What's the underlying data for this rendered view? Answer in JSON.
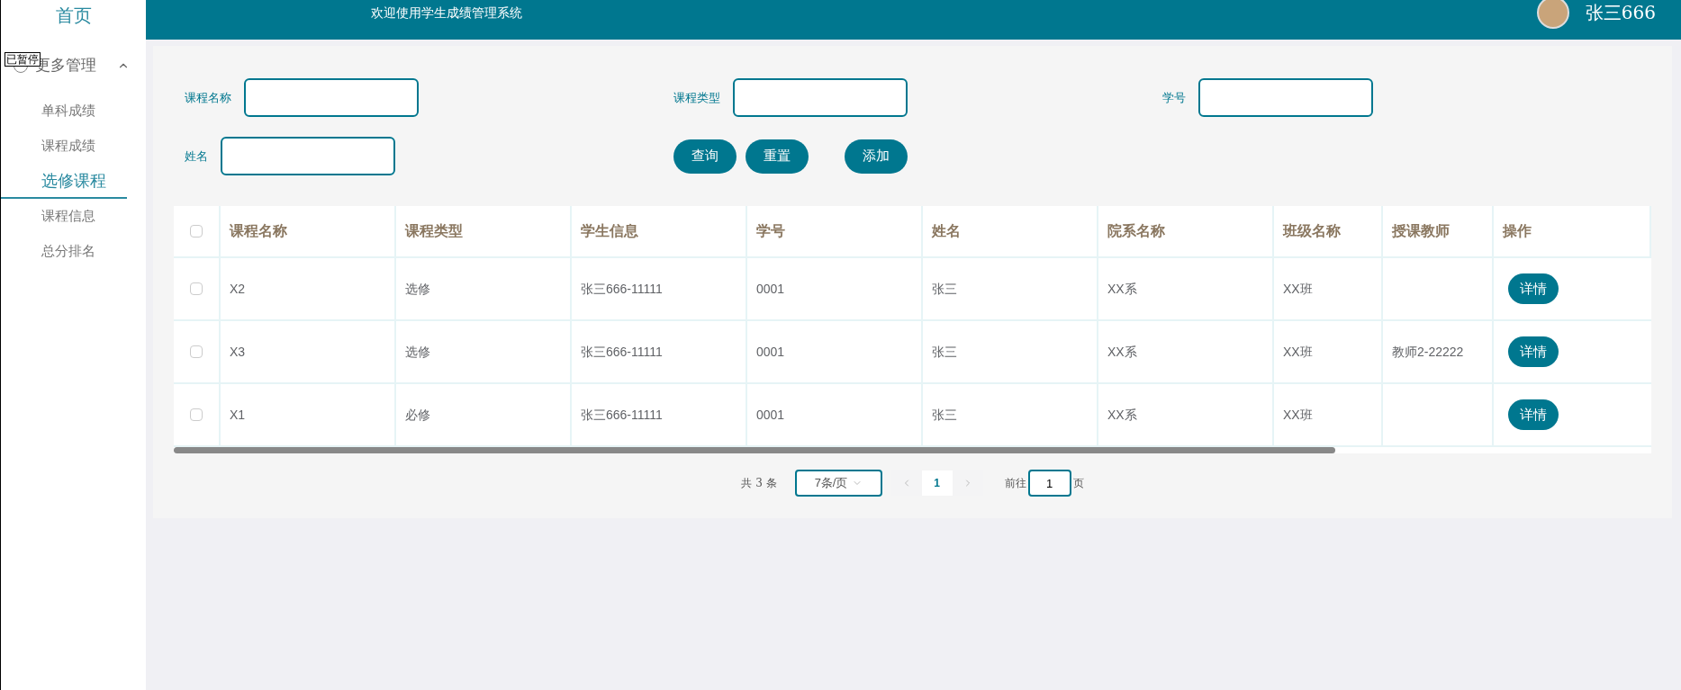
{
  "sidebar": {
    "home": "首页",
    "group": {
      "label": "更多管理",
      "expanded": true,
      "items": [
        {
          "label": "单科成绩",
          "selected": false
        },
        {
          "label": "课程成绩",
          "selected": false
        },
        {
          "label": "选修课程",
          "selected": true
        },
        {
          "label": "课程信息",
          "selected": false
        },
        {
          "label": "总分排名",
          "selected": false
        }
      ]
    }
  },
  "overlay_label": "已暂停",
  "header": {
    "title": "欢迎使用学生成绩管理系统",
    "user": "张三666"
  },
  "filters": [
    {
      "label": "课程名称"
    },
    {
      "label": "课程类型"
    },
    {
      "label": "学号"
    },
    {
      "label": "姓名"
    }
  ],
  "buttons": [
    "查询",
    "重置",
    "添加"
  ],
  "table": {
    "select_all_checked": false,
    "columns": [
      "课程名称",
      "课程类型",
      "学生信息",
      "学号",
      "姓名",
      "院系名称",
      "班级名称",
      "授课教师",
      "操作"
    ],
    "rows": [
      {
        "checked": false,
        "cells": [
          "X2",
          "选修",
          "张三666-11111",
          "0001",
          "张三",
          "XX系",
          "XX班",
          null
        ],
        "action": "详情"
      },
      {
        "checked": false,
        "cells": [
          "X3",
          "选修",
          "张三666-11111",
          "0001",
          "张三",
          "XX系",
          "XX班",
          "教师2-22222"
        ],
        "action": "详情"
      },
      {
        "checked": false,
        "cells": [
          "X1",
          "必修",
          "张三666-11111",
          "0001",
          "张三",
          "XX系",
          "XX班",
          null
        ],
        "action": "详情"
      }
    ]
  },
  "pagination": {
    "total": "共 3 条",
    "page_size": "7条/页",
    "pages": [
      {
        "label": "1",
        "selected": true
      }
    ],
    "goto_label": "前往",
    "goto_value": "1",
    "goto_suffix": "页"
  }
}
